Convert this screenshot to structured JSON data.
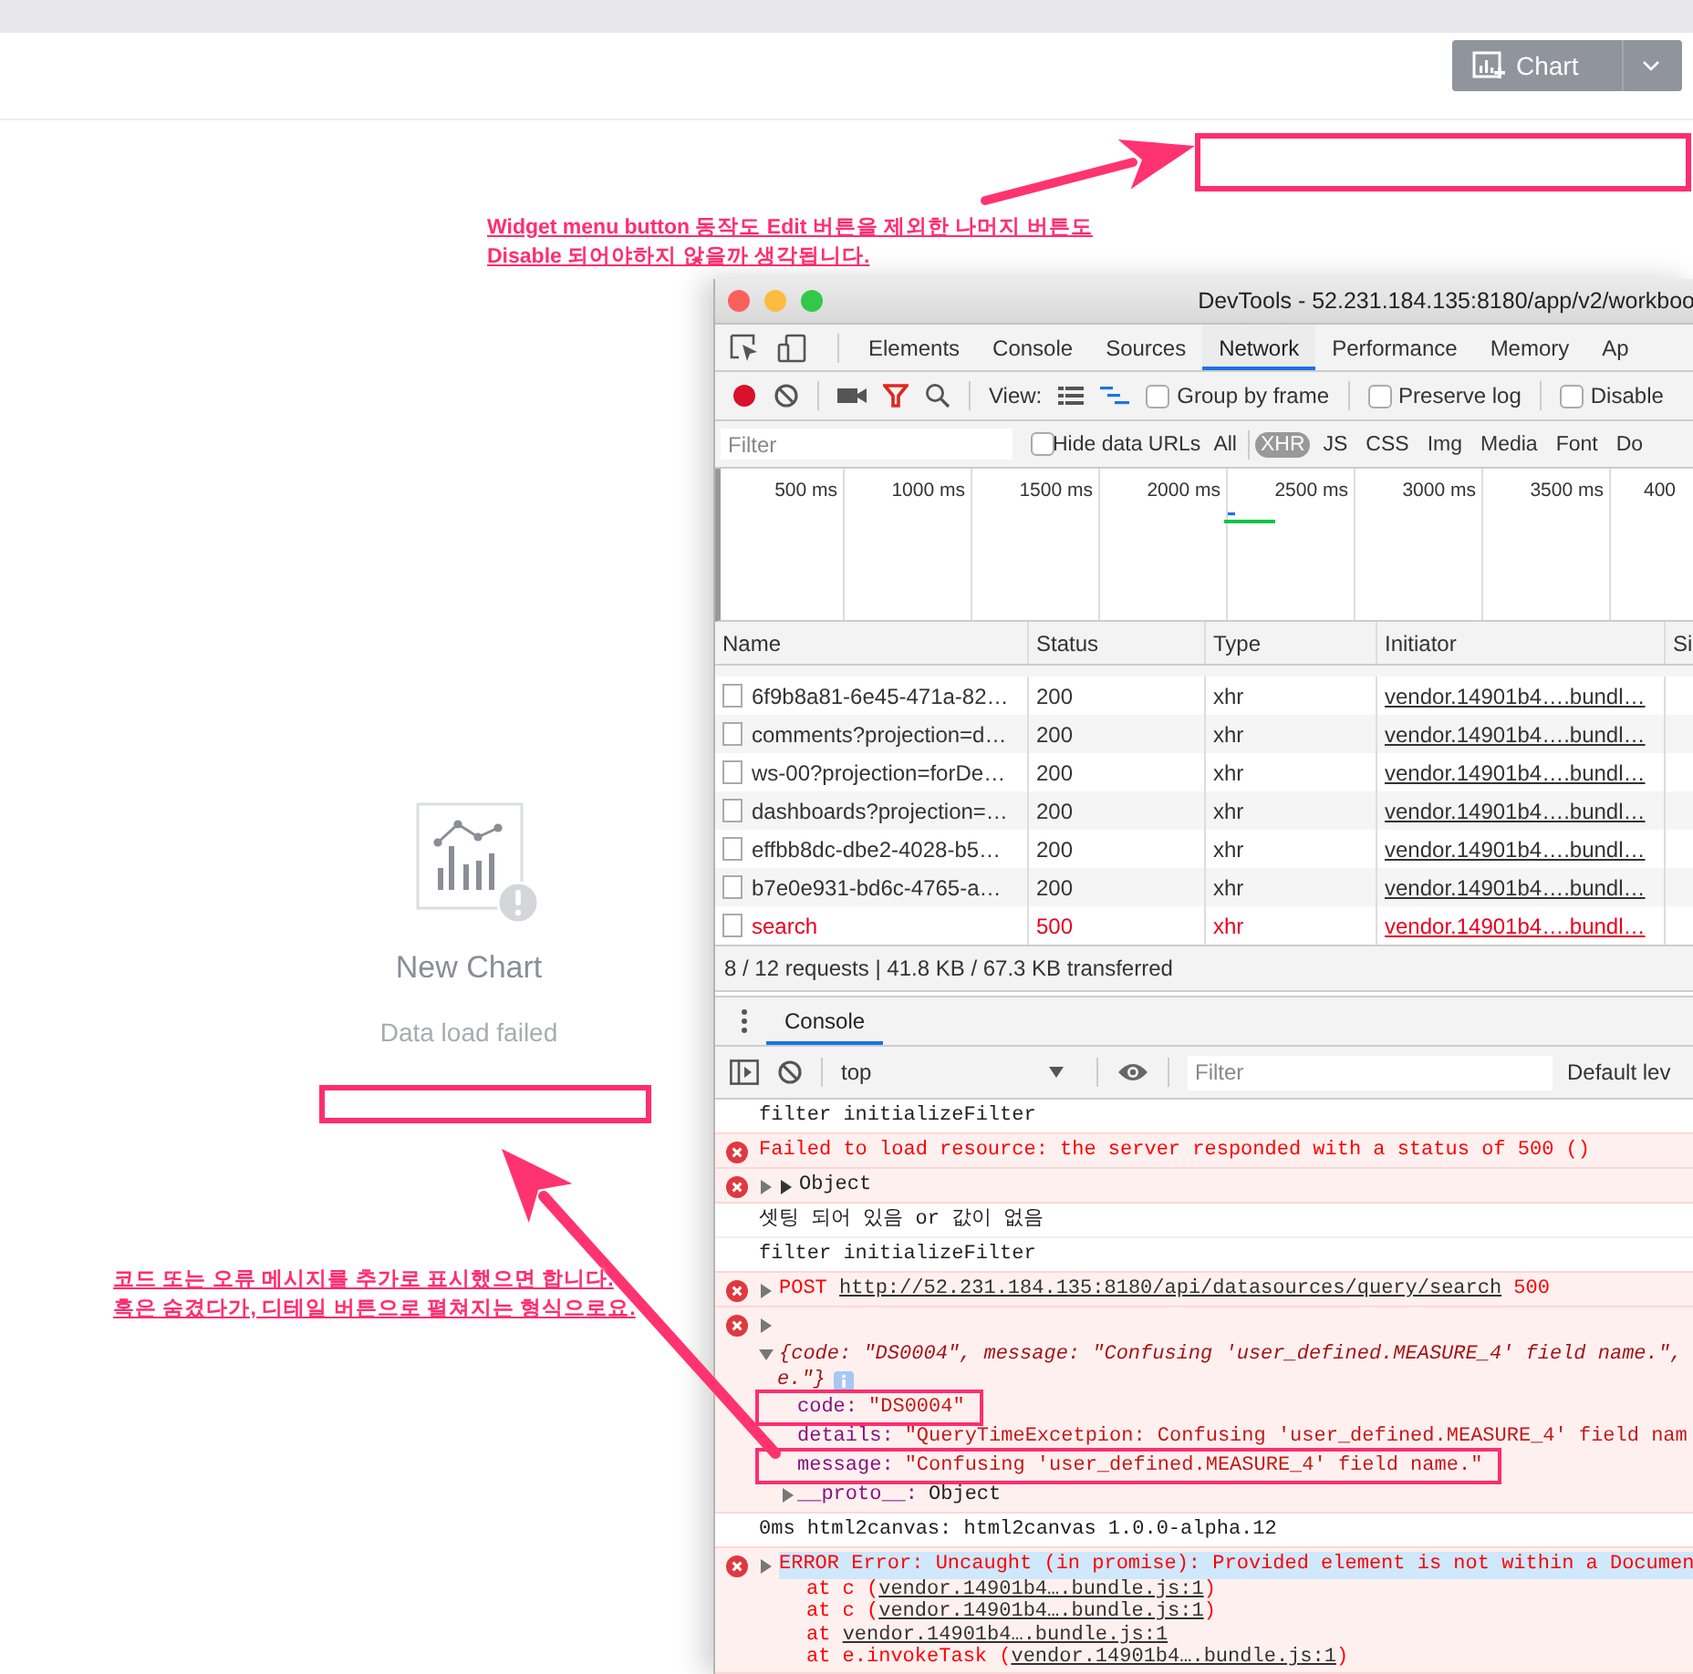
{
  "header": {
    "chart_button": {
      "label": "Chart"
    }
  },
  "widget": {
    "title": "New Chart",
    "message": "Data load failed"
  },
  "annotations": [
    {
      "text": "Widget menu button 동작도 Edit 버튼을 제외한 나머지 버튼도\nDisable 되어야하지 않을까 생각됩니다."
    },
    {
      "text": "코드 또는 오류 메시지를 추가로 표시했으면 합니다.\n혹은 숨겼다가, 디테일 버튼으로 펼쳐지는 형식으로요."
    }
  ],
  "devtools": {
    "title": "DevTools - 52.231.184.135:8180/app/v2/workboo",
    "tabs": [
      {
        "label": "Elements",
        "selected": false
      },
      {
        "label": "Console",
        "selected": false
      },
      {
        "label": "Sources",
        "selected": false
      },
      {
        "label": "Network",
        "selected": true
      },
      {
        "label": "Performance",
        "selected": false
      },
      {
        "label": "Memory",
        "selected": false
      },
      {
        "label": "Ap",
        "selected": false
      }
    ],
    "toolbar": {
      "recording": true,
      "view_label": "View:",
      "checkboxes": [
        {
          "label": "Group by frame",
          "checked": false
        },
        {
          "label": "Preserve log",
          "checked": false
        },
        {
          "label": "Disable",
          "checked": false
        }
      ]
    },
    "filter": {
      "placeholder": "Filter",
      "hide_data_urls": {
        "label": "Hide data URLs",
        "checked": false
      },
      "types": [
        {
          "label": "All",
          "selected": false
        },
        {
          "label": "XHR",
          "selected": true
        },
        {
          "label": "JS",
          "selected": false
        },
        {
          "label": "CSS",
          "selected": false
        },
        {
          "label": "Img",
          "selected": false
        },
        {
          "label": "Media",
          "selected": false
        },
        {
          "label": "Font",
          "selected": false
        },
        {
          "label": "Do",
          "selected": false
        }
      ]
    },
    "timeline": {
      "ticks": [
        "500 ms",
        "1000 ms",
        "1500 ms",
        "2000 ms",
        "2500 ms",
        "3000 ms",
        "3500 ms",
        "400"
      ]
    },
    "table": {
      "columns": [
        "Name",
        "Status",
        "Type",
        "Initiator",
        "Si"
      ],
      "rows": [
        {
          "name": "6f9b8a81-6e45-471a-82…",
          "status": "200",
          "type": "xhr",
          "initiator": "vendor.14901b4….bundl…",
          "failed": false
        },
        {
          "name": "comments?projection=d…",
          "status": "200",
          "type": "xhr",
          "initiator": "vendor.14901b4….bundl…",
          "failed": false
        },
        {
          "name": "ws-00?projection=forDe…",
          "status": "200",
          "type": "xhr",
          "initiator": "vendor.14901b4….bundl…",
          "failed": false
        },
        {
          "name": "dashboards?projection=…",
          "status": "200",
          "type": "xhr",
          "initiator": "vendor.14901b4….bundl…",
          "failed": false
        },
        {
          "name": "effbb8dc-dbe2-4028-b5…",
          "status": "200",
          "type": "xhr",
          "initiator": "vendor.14901b4….bundl…",
          "failed": false
        },
        {
          "name": "b7e0e931-bd6c-4765-a…",
          "status": "200",
          "type": "xhr",
          "initiator": "vendor.14901b4….bundl…",
          "failed": false
        },
        {
          "name": "search",
          "status": "500",
          "type": "xhr",
          "initiator": "vendor.14901b4….bundl…",
          "failed": true
        }
      ]
    },
    "summary": "8 / 12 requests | 41.8 KB / 67.3 KB transferred",
    "drawer_tabs": [
      {
        "label": "Console",
        "selected": true
      }
    ],
    "console": {
      "context": "top",
      "filter_placeholder": "Filter",
      "levels": "Default lev",
      "messages": [
        {
          "kind": "log",
          "text": "filter initializeFilter"
        },
        {
          "kind": "error",
          "text": "Failed to load resource: the server responded with a status of 500 ()"
        },
        {
          "kind": "object",
          "text": "Object"
        },
        {
          "kind": "log",
          "text": "셋팅 되어 있음 or 값이 없음"
        },
        {
          "kind": "log",
          "text": "filter initializeFilter"
        },
        {
          "kind": "request",
          "method": "POST",
          "url": "http://52.231.184.135:8180/api/datasources/query/search",
          "status": "500"
        },
        {
          "kind": "expanded",
          "summary": "{code: \"DS0004\", message: \"Confusing 'user_defined.MEASURE_4' field name.\",",
          "summary_end": "e.\"}",
          "properties": [
            {
              "key": "code:",
              "value": "\"DS0004\"",
              "outlined": true,
              "expandable": false
            },
            {
              "key": "details:",
              "value": "\"QueryTimeExcetpion: Confusing 'user_defined.MEASURE_4' field nam",
              "outlined": false,
              "expandable": false
            },
            {
              "key": "message:",
              "value": "\"Confusing 'user_defined.MEASURE_4' field name.\"",
              "outlined": true,
              "expandable": false
            },
            {
              "key": "__proto__:",
              "value": "Object",
              "outlined": false,
              "expandable": true
            }
          ]
        },
        {
          "kind": "log",
          "text": "0ms html2canvas: html2canvas 1.0.0-alpha.12"
        },
        {
          "kind": "stack",
          "text": "ERROR Error: Uncaught (in promise): Provided element is not within a Documen",
          "highlighted": true,
          "frames": [
            {
              "prefix": "at c (",
              "link": "vendor.14901b4….bundle.js:1",
              "suffix": ")"
            },
            {
              "prefix": "at c (",
              "link": "vendor.14901b4….bundle.js:1",
              "suffix": ")"
            },
            {
              "prefix": "at ",
              "link": "vendor.14901b4….bundle.js:1"
            },
            {
              "prefix": "at e.invokeTask (",
              "link": "vendor.14901b4….bundle.js:1",
              "suffix": ")"
            }
          ]
        }
      ]
    }
  }
}
